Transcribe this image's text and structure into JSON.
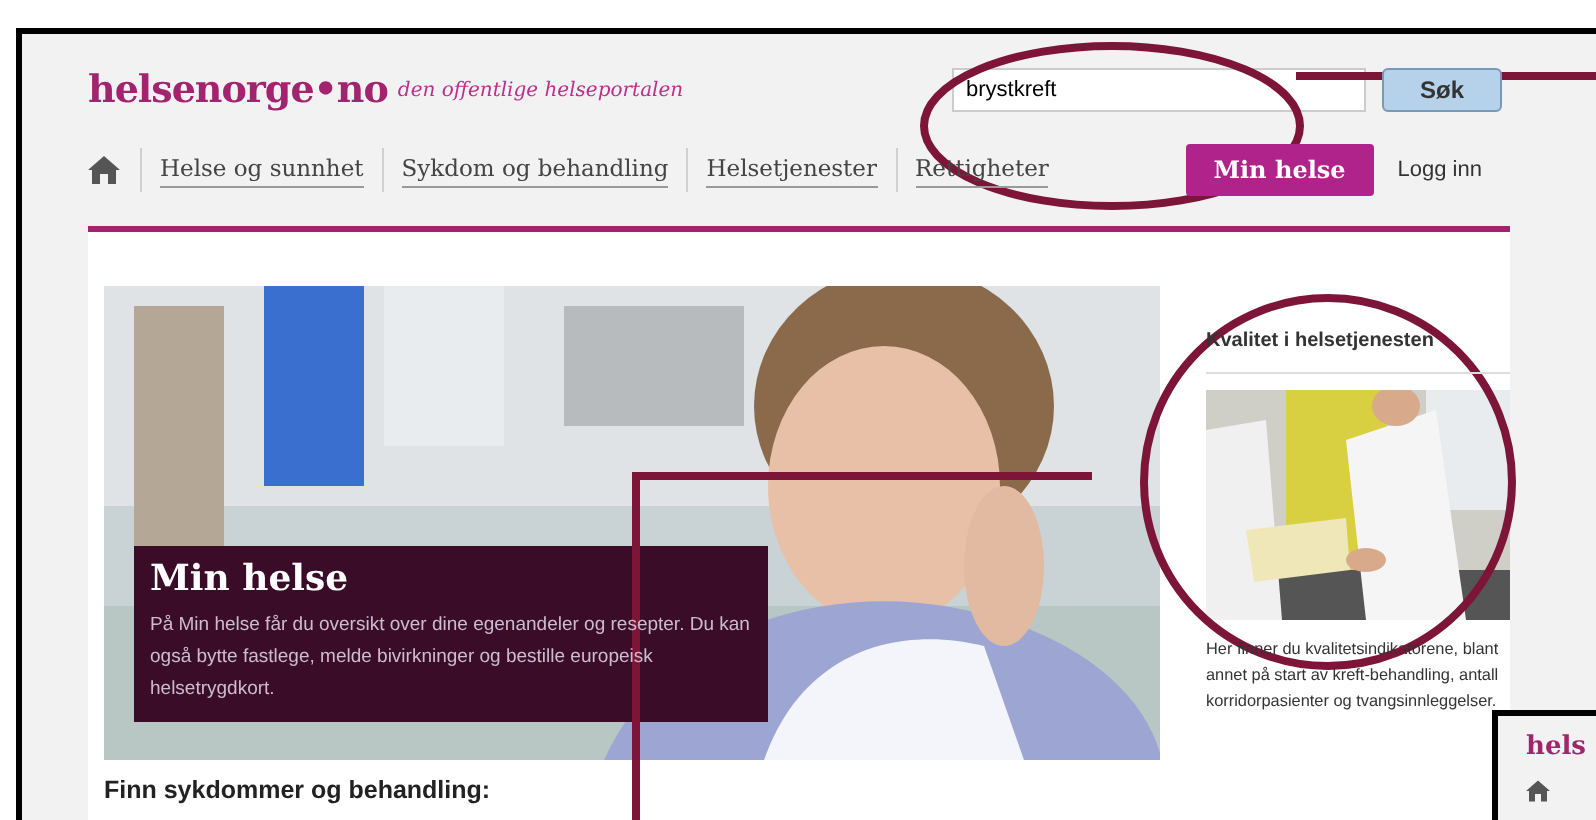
{
  "header": {
    "logo": {
      "name": "helsenorge",
      "dot": "•",
      "suffix": "no"
    },
    "tagline": "den offentlige helseportalen",
    "search": {
      "value": "brystkreft",
      "button": "Søk"
    }
  },
  "nav": {
    "items": [
      {
        "label": "Helse og sunnhet"
      },
      {
        "label": "Sykdom og behandling"
      },
      {
        "label": "Helsetjenester"
      },
      {
        "label": "Rettigheter"
      }
    ],
    "primary_button": "Min helse",
    "login": "Logg inn"
  },
  "hero": {
    "kind": "picture",
    "title": "Min helse",
    "text": "På Min helse får du oversikt over dine egenandeler og resepter. Du kan også bytte fastlege, melde bivirkninger og bestille europeisk helsetrygdkort."
  },
  "sidebar": {
    "heading": "Kvalitet i helsetjenesten",
    "text": "Her finner du kvalitetsindikatorene, blant annet på start av kreft-behandling, antall korridorpasienter og tvangsinnleggelser."
  },
  "section_heading": "Finn sykdommer og behandling:",
  "second_screenshot": {
    "logo_fragment": "hels"
  }
}
